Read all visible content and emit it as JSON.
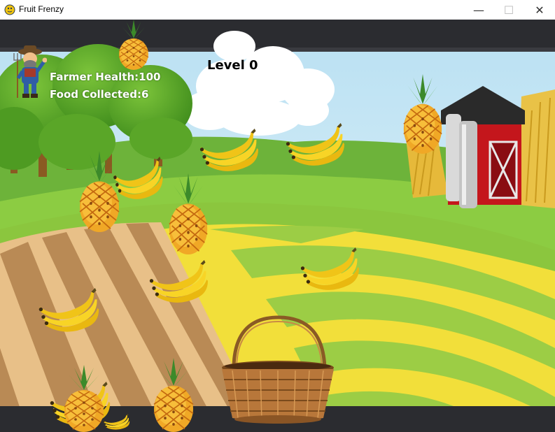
{
  "window": {
    "title": "Fruit Frenzy",
    "icon": "pygame-snake-icon",
    "controls": [
      "minimize",
      "maximize",
      "close"
    ]
  },
  "hud": {
    "health_label": "Farmer Health:100",
    "food_label": "Food Collected:6",
    "level_label": "Level 0"
  },
  "colors": {
    "bar": "#2b2c30",
    "sky": "#c8e6f4",
    "field_yellow": "#f2df3a",
    "field_green": "#8bc63e",
    "barn_red": "#c4161c"
  },
  "fruits": [
    {
      "type": "pineapple"
    },
    {
      "type": "pineapple"
    },
    {
      "type": "banana"
    },
    {
      "type": "banana"
    },
    {
      "type": "banana"
    },
    {
      "type": "pineapple"
    },
    {
      "type": "pineapple"
    },
    {
      "type": "banana"
    },
    {
      "type": "banana"
    },
    {
      "type": "banana"
    },
    {
      "type": "pineapple"
    },
    {
      "type": "pineapple"
    },
    {
      "type": "banana"
    }
  ]
}
